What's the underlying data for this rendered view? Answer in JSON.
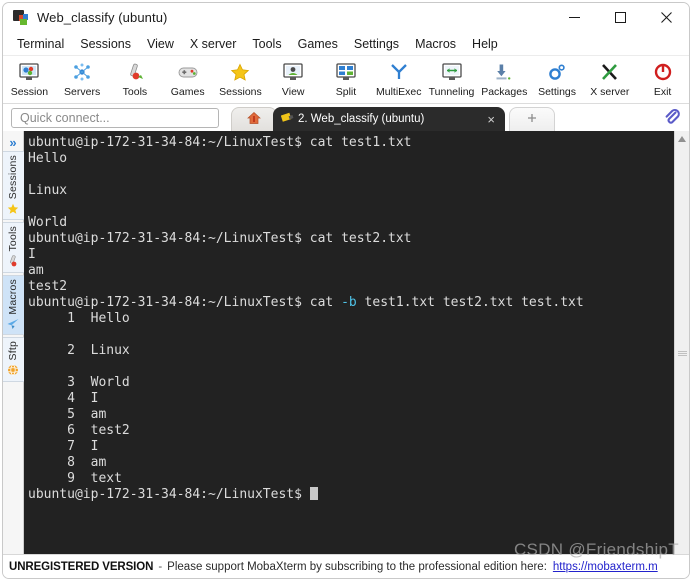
{
  "window": {
    "title": "Web_classify (ubuntu)",
    "icon": "mobaxterm-logo-icon",
    "buttons": {
      "minimize": "minimize-button",
      "maximize": "maximize-button",
      "close": "close-button"
    }
  },
  "menubar": {
    "items": [
      {
        "label": "Terminal"
      },
      {
        "label": "Sessions"
      },
      {
        "label": "View"
      },
      {
        "label": "X server"
      },
      {
        "label": "Tools"
      },
      {
        "label": "Games"
      },
      {
        "label": "Settings"
      },
      {
        "label": "Macros"
      },
      {
        "label": "Help"
      }
    ]
  },
  "toolbar": {
    "items": [
      {
        "label": "Session",
        "icon": "session-icon"
      },
      {
        "label": "Servers",
        "icon": "servers-icon"
      },
      {
        "label": "Tools",
        "icon": "tools-icon"
      },
      {
        "label": "Games",
        "icon": "games-icon"
      },
      {
        "label": "Sessions",
        "icon": "sessions-star-icon"
      },
      {
        "label": "View",
        "icon": "view-icon"
      },
      {
        "label": "Split",
        "icon": "split-icon"
      },
      {
        "label": "MultiExec",
        "icon": "multiexec-icon"
      },
      {
        "label": "Tunneling",
        "icon": "tunneling-icon"
      },
      {
        "label": "Packages",
        "icon": "packages-icon"
      },
      {
        "label": "Settings",
        "icon": "settings-gear-icon"
      },
      {
        "label": "X server",
        "icon": "xserver-icon"
      },
      {
        "label": "Exit",
        "icon": "exit-power-icon"
      }
    ]
  },
  "quick_connect": {
    "placeholder": "Quick connect...",
    "value": ""
  },
  "tabs": {
    "home_icon": "home-icon",
    "new_tab_label": "+",
    "items": [
      {
        "label": "2. Web_classify (ubuntu)",
        "icon": "terminal-tab-icon",
        "active": true,
        "close": "×"
      }
    ],
    "clip_icon": "paperclip-icon"
  },
  "sidebar": {
    "expand_icon": "»",
    "items": [
      {
        "label": "Sessions",
        "icon": "star-icon",
        "selected": false
      },
      {
        "label": "Tools",
        "icon": "wrench-icon",
        "selected": false
      },
      {
        "label": "Macros",
        "icon": "paper-plane-icon",
        "selected": true
      },
      {
        "label": "Sftp",
        "icon": "globe-icon",
        "selected": false
      }
    ]
  },
  "terminal": {
    "prompt": "ubuntu@ip-172-31-34-84:~/LinuxTest$ ",
    "lines": [
      {
        "type": "prompt",
        "cmd": "cat test1.txt"
      },
      {
        "type": "out",
        "text": "Hello"
      },
      {
        "type": "out",
        "text": ""
      },
      {
        "type": "out",
        "text": "Linux"
      },
      {
        "type": "out",
        "text": ""
      },
      {
        "type": "out",
        "text": "World"
      },
      {
        "type": "prompt",
        "cmd": "cat test2.txt"
      },
      {
        "type": "out",
        "text": "I"
      },
      {
        "type": "out",
        "text": "am"
      },
      {
        "type": "out",
        "text": "test2"
      },
      {
        "type": "prompt",
        "cmd": "cat ",
        "flag": "-b",
        "cmd_tail": " test1.txt test2.txt test.txt"
      },
      {
        "type": "out",
        "text": "     1\tHello"
      },
      {
        "type": "out",
        "text": ""
      },
      {
        "type": "out",
        "text": "     2\tLinux"
      },
      {
        "type": "out",
        "text": ""
      },
      {
        "type": "out",
        "text": "     3\tWorld"
      },
      {
        "type": "out",
        "text": "     4\tI"
      },
      {
        "type": "out",
        "text": "     5\tam"
      },
      {
        "type": "out",
        "text": "     6\ttest2"
      },
      {
        "type": "out",
        "text": "     7\tI"
      },
      {
        "type": "out",
        "text": "     8\tam"
      },
      {
        "type": "out",
        "text": "     9\ttext"
      },
      {
        "type": "prompt_cursor",
        "cmd": ""
      }
    ],
    "colors": {
      "background": "#222222",
      "foreground": "#dcdcdc",
      "flag": "#4fc3e8",
      "cursor": "#c8c8c8"
    }
  },
  "statusbar": {
    "unregistered": "UNREGISTERED VERSION",
    "separator": "-",
    "message": "Please support MobaXterm by subscribing to the professional edition here:",
    "link": "https://mobaxterm.m"
  },
  "watermark": "CSDN @FriendshipT"
}
